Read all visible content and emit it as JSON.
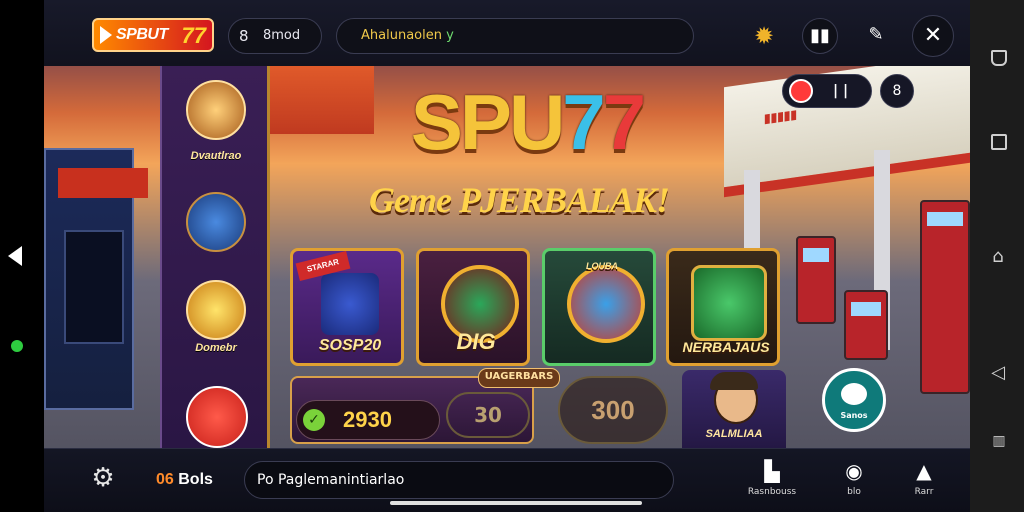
{
  "app": {
    "logo_text": "SPBUT",
    "logo_number": "77",
    "user_label": "8mod",
    "search_text": "Ahalunaolen",
    "search_suffix": "y"
  },
  "hero": {
    "title_main": "SPU",
    "title_seven_a": "7",
    "title_seven_b": "7",
    "subtitle": "Geme PJERBALAK!"
  },
  "top_right": {
    "pause_label": "| |",
    "round_label": "8"
  },
  "side_menu": {
    "items": [
      {
        "label": "Dvautlrao",
        "icon": "character-icon"
      },
      {
        "label": "",
        "icon": "fuel-nozzle-icon"
      },
      {
        "label": "Domebr",
        "icon": "lightning-icon"
      },
      {
        "label": "",
        "icon": "shopping-bag-icon"
      }
    ]
  },
  "cards": [
    {
      "label": "SOSP20",
      "tag": "STARAR"
    },
    {
      "label": "DIG",
      "tag": ""
    },
    {
      "label": "",
      "tag": "LOUBA"
    },
    {
      "label": "NERBAJAUS",
      "tag": ""
    }
  ],
  "jackpot": {
    "title": "UAGERBARS",
    "value": "2930",
    "coin_small": "30",
    "coin_big": "300"
  },
  "character_card": {
    "name": "SALMLIAA"
  },
  "fab": {
    "label": "Sanos"
  },
  "bottom": {
    "coins_prefix": "06",
    "coins_label": "Bols",
    "chat_text": "Po Paglemanintiarlao",
    "chat_suffix": "",
    "buttons": [
      {
        "label": "Rasnbouss",
        "icon": "leaderboard-icon"
      },
      {
        "label": "blo",
        "icon": "notification-icon"
      },
      {
        "label": "Rarr",
        "icon": "trophy-icon"
      }
    ]
  },
  "colors": {
    "accent": "#f5c43a",
    "brand_red": "#d4161f",
    "panel_purple": "#3a1f55",
    "fab_teal": "#0f7a7a"
  }
}
